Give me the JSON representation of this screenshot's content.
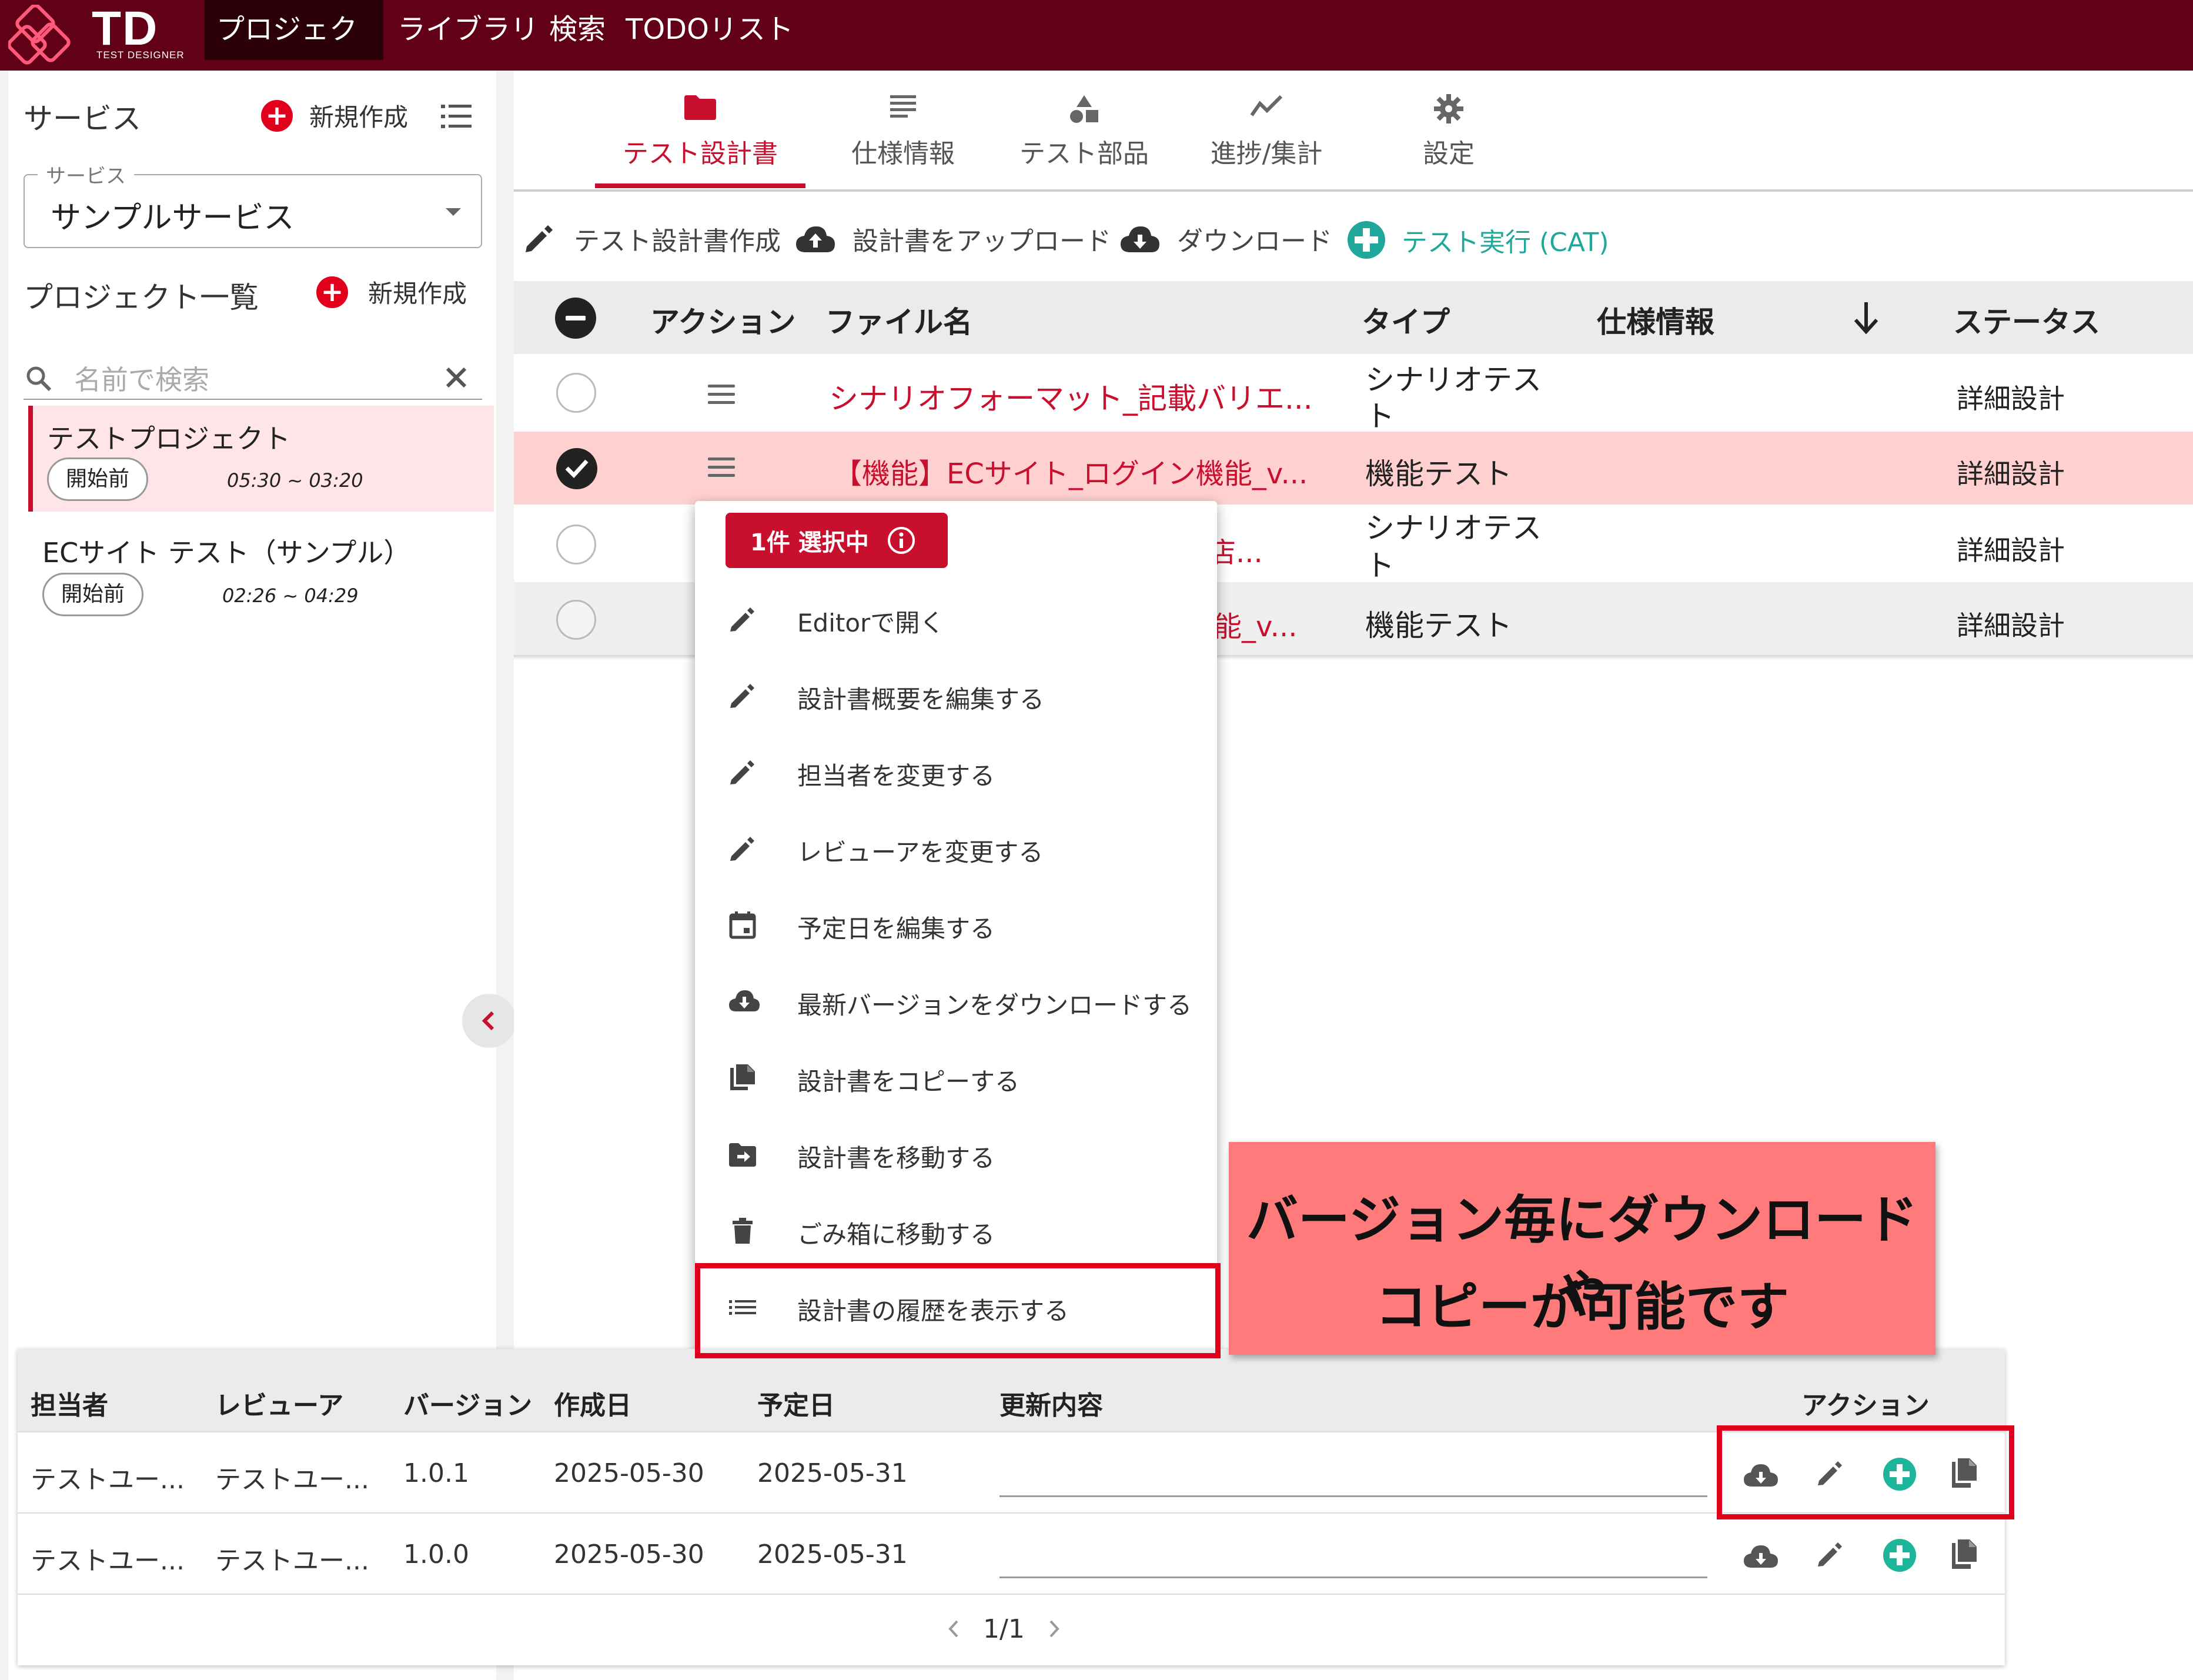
{
  "colors": {
    "brand_dark": "#620018",
    "accent_red": "#c8102e",
    "highlight_row": "#ffd0d0",
    "teal": "#1fa89a",
    "callout_bg": "#ff7b7b"
  },
  "header": {
    "logo_text": "TD",
    "logo_sub": "TEST DESIGNER",
    "nav": [
      "プロジェクト",
      "ライブラリ",
      "検索",
      "TODOリスト"
    ]
  },
  "sidebar": {
    "service_title": "サービス",
    "new_label": "新規作成",
    "service_select_legend": "サービス",
    "service_select_value": "サンプルサービス",
    "projects_title": "プロジェクト一覧",
    "projects_new_label": "新規作成",
    "search_placeholder": "名前で検索",
    "projects": [
      {
        "name": "テストプロジェクト",
        "status": "開始前",
        "time": "05:30 ~ 03:20"
      },
      {
        "name": "ECサイト テスト（サンプル）",
        "status": "開始前",
        "time": "02:26 ~ 04:29"
      }
    ]
  },
  "tabs": [
    {
      "label": "テスト設計書",
      "icon": "folder-icon"
    },
    {
      "label": "仕様情報",
      "icon": "list-icon"
    },
    {
      "label": "テスト部品",
      "icon": "shapes-icon"
    },
    {
      "label": "進捗/集計",
      "icon": "chart-line-icon"
    },
    {
      "label": "設定",
      "icon": "gear-icon"
    }
  ],
  "toolbar": {
    "create": "テスト設計書作成",
    "upload": "設計書をアップロード",
    "download": "ダウンロード",
    "run": "テスト実行 (CAT)"
  },
  "table": {
    "headers": {
      "action": "アクション",
      "filename": "ファイル名",
      "type": "タイプ",
      "spec": "仕様情報",
      "status": "ステータス"
    },
    "rows": [
      {
        "file": "シナリオフォーマット_記載バリエ...",
        "type_l1": "シナリオテス",
        "type_l2": "ト",
        "status": "詳細設計"
      },
      {
        "file": "【機能】ECサイト_ログイン機能_v...",
        "type_l1": "機能テスト",
        "type_l2": "",
        "status": "詳細設計"
      },
      {
        "file": "店...",
        "type_l1": "シナリオテス",
        "type_l2": "ト",
        "status": "詳細設計"
      },
      {
        "file": "能_v...",
        "type_l1": "機能テスト",
        "type_l2": "",
        "status": "詳細設計"
      }
    ]
  },
  "menu": {
    "badge": "1件 選択中",
    "items": [
      {
        "label": "Editorで開く",
        "icon": "pencil-icon"
      },
      {
        "label": "設計書概要を編集する",
        "icon": "pencil-icon"
      },
      {
        "label": "担当者を変更する",
        "icon": "pencil-icon"
      },
      {
        "label": "レビューアを変更する",
        "icon": "pencil-icon"
      },
      {
        "label": "予定日を編集する",
        "icon": "calendar-icon"
      },
      {
        "label": "最新バージョンをダウンロードする",
        "icon": "cloud-download-icon"
      },
      {
        "label": "設計書をコピーする",
        "icon": "copy-icon"
      },
      {
        "label": "設計書を移動する",
        "icon": "folder-move-icon"
      },
      {
        "label": "ごみ箱に移動する",
        "icon": "trash-icon"
      },
      {
        "label": "設計書の履歴を表示する",
        "icon": "list-icon"
      }
    ]
  },
  "history": {
    "headers": {
      "assignee": "担当者",
      "reviewer": "レビューア",
      "version": "バージョン",
      "created": "作成日",
      "due": "予定日",
      "update": "更新内容",
      "action": "アクション"
    },
    "rows": [
      {
        "assignee": "テストユー...",
        "reviewer": "テストユー...",
        "version": "1.0.1",
        "created": "2025-05-30",
        "due": "2025-05-31"
      },
      {
        "assignee": "テストユー...",
        "reviewer": "テストユー...",
        "version": "1.0.0",
        "created": "2025-05-30",
        "due": "2025-05-31"
      }
    ],
    "pager": "1/1"
  },
  "callout": {
    "line1": "バージョン毎にダウンロードや",
    "line2": "コピーが可能です"
  }
}
